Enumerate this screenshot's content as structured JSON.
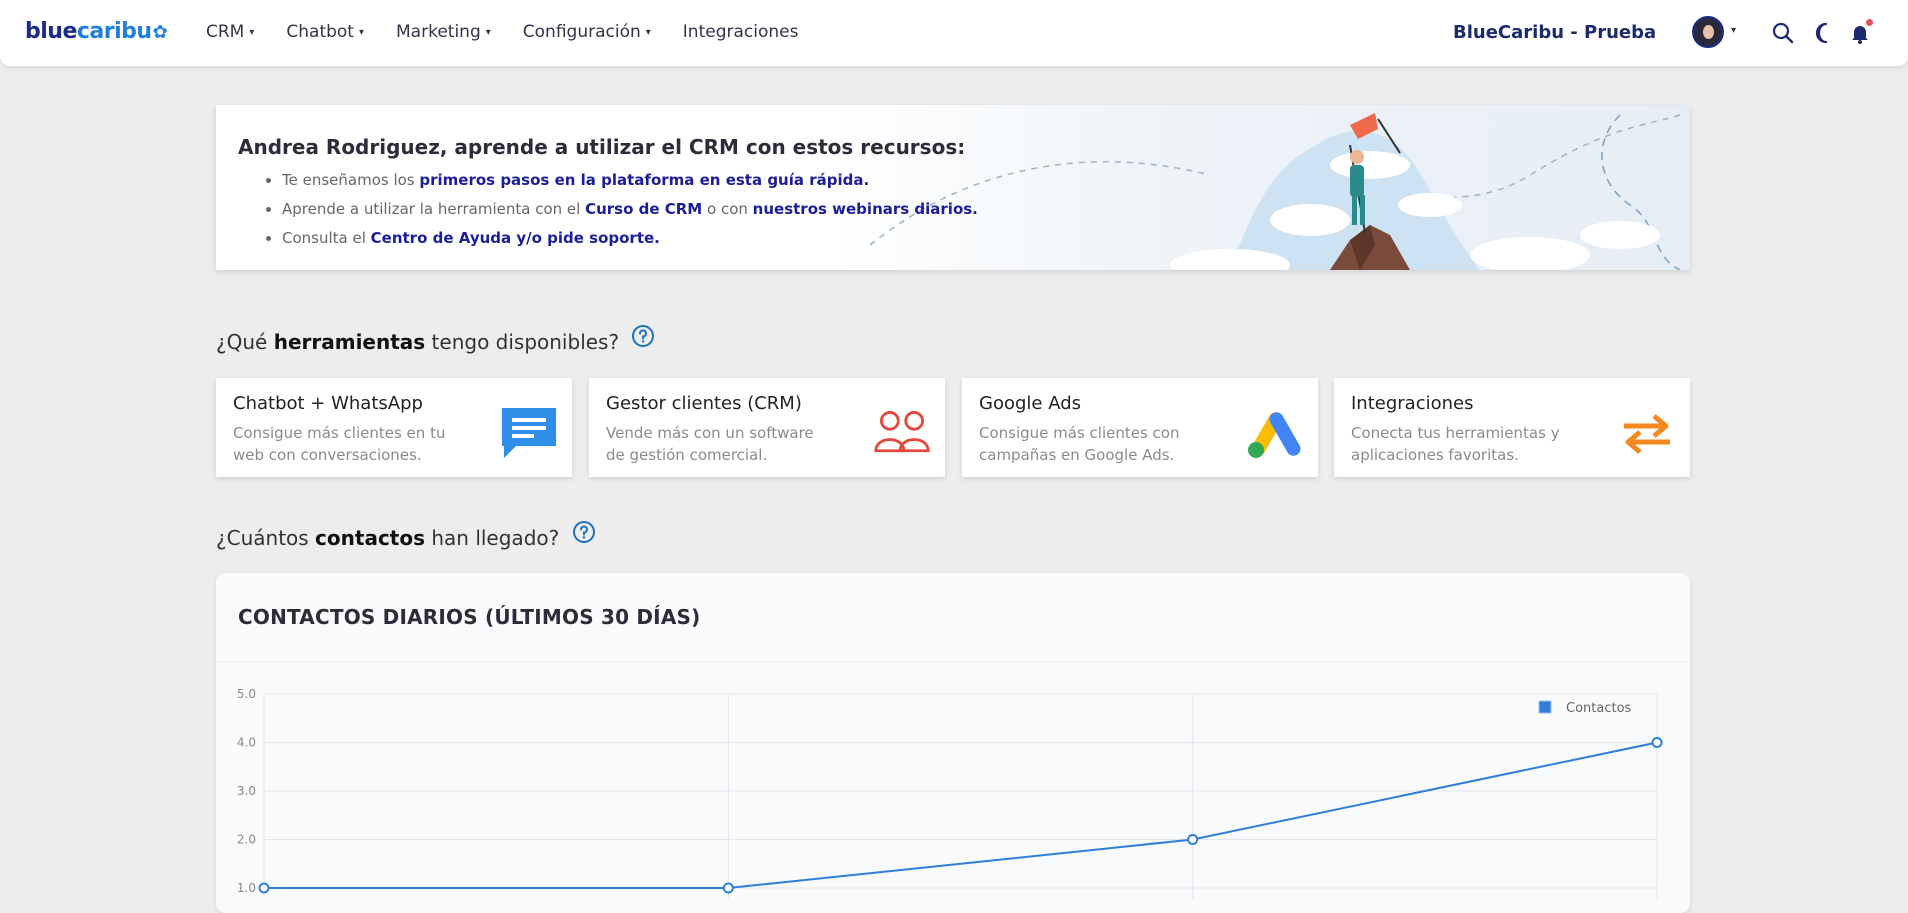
{
  "header": {
    "logo": {
      "part1": "blue",
      "part2": "caribu"
    },
    "nav": [
      {
        "label": "CRM",
        "dropdown": true
      },
      {
        "label": "Chatbot",
        "dropdown": true
      },
      {
        "label": "Marketing",
        "dropdown": true
      },
      {
        "label": "Configuración",
        "dropdown": true
      },
      {
        "label": "Integraciones",
        "dropdown": false
      }
    ],
    "account_name": "BlueCaribu - Prueba",
    "icons": [
      "user-avatar",
      "search-icon",
      "moon-icon",
      "bell-icon"
    ]
  },
  "banner": {
    "title": "Andrea Rodriguez, aprende a utilizar el CRM con estos recursos:",
    "items": [
      {
        "pre": "Te enseñamos los ",
        "link1": "primeros pasos en la plataforma en esta guía rápida.",
        "mid": "",
        "link2": ""
      },
      {
        "pre": "Aprende a utilizar la herramienta con el ",
        "link1": "Curso de CRM",
        "mid": " o con ",
        "link2": "nuestros webinars diarios."
      },
      {
        "pre": "Consulta el ",
        "link1": "Centro de Ayuda y/o pide soporte.",
        "mid": "",
        "link2": ""
      }
    ]
  },
  "tools_section": {
    "pre": "¿Qué ",
    "bold": "herramientas",
    "post": " tengo disponibles?"
  },
  "cards": [
    {
      "title": "Chatbot + WhatsApp",
      "desc": "Consigue más clientes en tu web con conversaciones.",
      "icon": "chat-icon"
    },
    {
      "title": "Gestor clientes (CRM)",
      "desc": "Vende más con un software de gestión comercial.",
      "icon": "people-icon"
    },
    {
      "title": "Google Ads",
      "desc": "Consigue más clientes con campañas en Google Ads.",
      "icon": "google-ads-icon"
    },
    {
      "title": "Integraciones",
      "desc": "Conecta tus herramientas y aplicaciones favoritas.",
      "icon": "swap-arrows-icon"
    }
  ],
  "contacts_section": {
    "pre": "¿Cuántos ",
    "bold": "contactos",
    "post": " han llegado?"
  },
  "chart_panel_title": "CONTACTOS DIARIOS (ÚLTIMOS 30 DÍAS)",
  "colors": {
    "brand_dark": "#1c2a8a",
    "brand_light": "#1e7fe0",
    "link": "#1b1e9a",
    "series": "#2f7fd8"
  },
  "chart_data": {
    "type": "line",
    "title": "",
    "xlabel": "",
    "ylabel": "",
    "x": [
      1,
      2,
      3,
      4
    ],
    "series": [
      {
        "name": "Contactos",
        "values": [
          1,
          1,
          2,
          4
        ]
      }
    ],
    "ylim": [
      1,
      5
    ],
    "yticks": [
      "1.0",
      "2.0",
      "3.0",
      "4.0",
      "5.0"
    ],
    "grid": true,
    "legend": "top-right"
  }
}
